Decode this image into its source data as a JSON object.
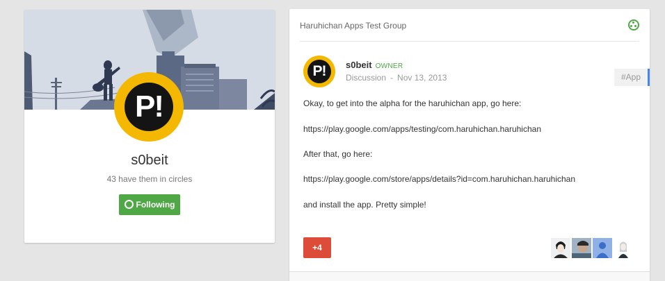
{
  "profile": {
    "name": "s0beit",
    "circles": "43 have them in circles",
    "follow_label": "Following",
    "avatar_text": "P!"
  },
  "post": {
    "group": "Haruhichan Apps Test Group",
    "author": "s0beit",
    "role": "OWNER",
    "category": "Discussion",
    "separator": "-",
    "date": "Nov 13, 2013",
    "hashtag": "#App",
    "lines": [
      "Okay, to get into the alpha for the haruhichan app, go here:",
      "https://play.google.com/apps/testing/com.haruhichan.haruhichan",
      "After that, go here:",
      "https://play.google.com/store/apps/details?id=com.haruhichan.haruhichan",
      "and install the app. Pretty simple!"
    ],
    "plus_count": "+4"
  },
  "colors": {
    "green": "#4fa845",
    "red": "#dd4b39",
    "yellow": "#f4b800",
    "blue_accent": "#4285f4"
  }
}
